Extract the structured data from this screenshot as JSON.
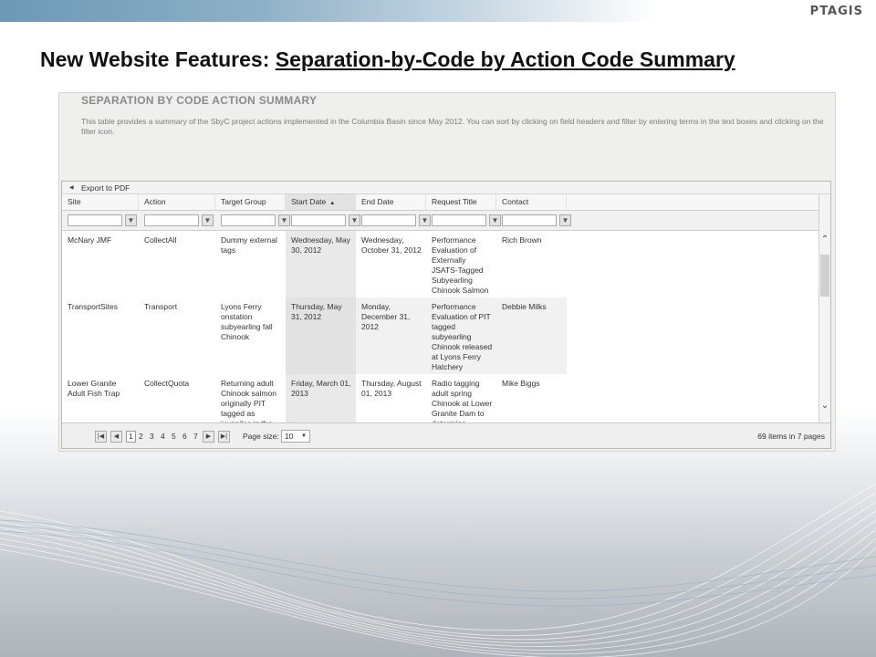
{
  "logo": "PTAGIS",
  "slide": {
    "title_prefix": "New Website Features: ",
    "title_link": "Separation-by-Code by Action Code Summary"
  },
  "panel": {
    "title": "SEPARATION BY CODE ACTION SUMMARY",
    "description": "This table provides a summary of the SbyC project actions implemented in the Columbia Basin since May 2012. You can sort by clicking on field headers and filter by entering terms in the text boxes and clicking on the filter icon."
  },
  "grid": {
    "export_label": "Export to PDF",
    "columns": [
      "Site",
      "Action",
      "Target Group",
      "Start Date",
      "End Date",
      "Request Title",
      "Contact"
    ],
    "sorted_column": "Start Date",
    "rows": [
      {
        "site": "McNary JMF",
        "action": "CollectAll",
        "target_group": "Dummy external tags",
        "start_date": "Wednesday, May 30, 2012",
        "end_date": "Wednesday, October 31, 2012",
        "request_title": "Performance Evaluation of Externally JSATS-Tagged Subyearling Chinook Salmon",
        "contact": "Rich Brown"
      },
      {
        "site": "TransportSites",
        "action": "Transport",
        "target_group": "Lyons Ferry onstation subyearling fall Chinook",
        "start_date": "Thursday, May 31, 2012",
        "end_date": "Monday, December 31, 2012",
        "request_title": "Performance Evaluation of PIT tagged subyearling Chinook released at Lyons Ferry Hatchery",
        "contact": "Debbie Milks"
      },
      {
        "site": "Lower Granite Adult Fish Trap",
        "action": "CollectQuota",
        "target_group": "Returning adult Chinook salmon originally PIT tagged as juveniles in the",
        "start_date": "Friday, March 01, 2013",
        "end_date": "Thursday, August 01, 2013",
        "request_title": "Radio tagging adult spring Chinook at Lower Granite Dam to determine",
        "contact": "Mike Biggs"
      }
    ]
  },
  "pager": {
    "first": "|◀",
    "prev": "◀",
    "pages": [
      "1",
      "2",
      "3",
      "4",
      "5",
      "6",
      "7"
    ],
    "current_page": "1",
    "next": "▶",
    "last": "▶|",
    "page_size_label": "Page size:",
    "page_size_value": "10",
    "info": "69 items in 7 pages"
  }
}
